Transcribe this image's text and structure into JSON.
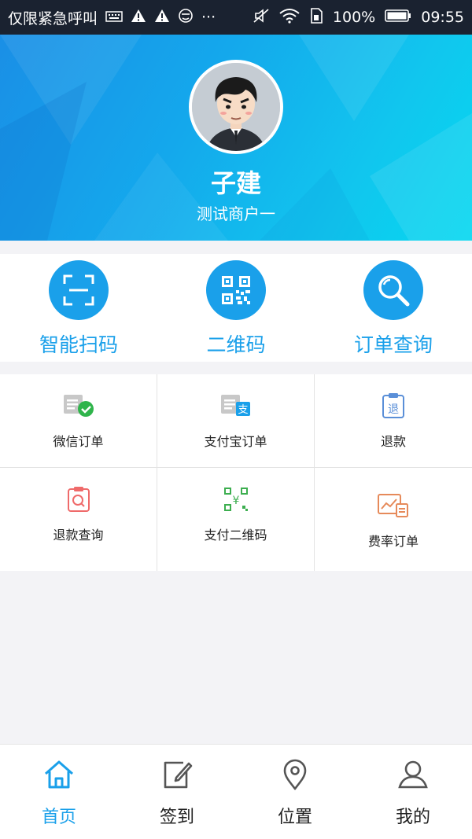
{
  "status_bar": {
    "carrier": "仅限紧急呼叫",
    "battery": "100%",
    "time": "09:55",
    "more": "···"
  },
  "profile": {
    "name": "子建",
    "merchant": "测试商户一"
  },
  "quick_actions": [
    {
      "label": "智能扫码",
      "icon": "scan-icon"
    },
    {
      "label": "二维码",
      "icon": "qr-code-icon"
    },
    {
      "label": "订单查询",
      "icon": "search-icon"
    }
  ],
  "grid": [
    {
      "label": "微信订单",
      "icon": "wechat-order-icon"
    },
    {
      "label": "支付宝订单",
      "icon": "alipay-order-icon"
    },
    {
      "label": "退款",
      "icon": "refund-icon"
    },
    {
      "label": "退款查询",
      "icon": "refund-query-icon"
    },
    {
      "label": "支付二维码",
      "icon": "payment-qr-icon"
    },
    {
      "label": "费率订单",
      "icon": "rate-order-icon"
    }
  ],
  "bottom_nav": [
    {
      "label": "首页",
      "icon": "home-icon",
      "active": true
    },
    {
      "label": "签到",
      "icon": "check-in-icon",
      "active": false
    },
    {
      "label": "位置",
      "icon": "location-icon",
      "active": false
    },
    {
      "label": "我的",
      "icon": "profile-icon",
      "active": false
    }
  ],
  "colors": {
    "accent": "#1aa0ea",
    "wechat_green": "#2fb44b",
    "refund_blue": "#5a8fd8",
    "refund_query_red": "#ef6a6a",
    "payment_qr_green": "#3cae4f",
    "rate_orange": "#e68a5a"
  }
}
